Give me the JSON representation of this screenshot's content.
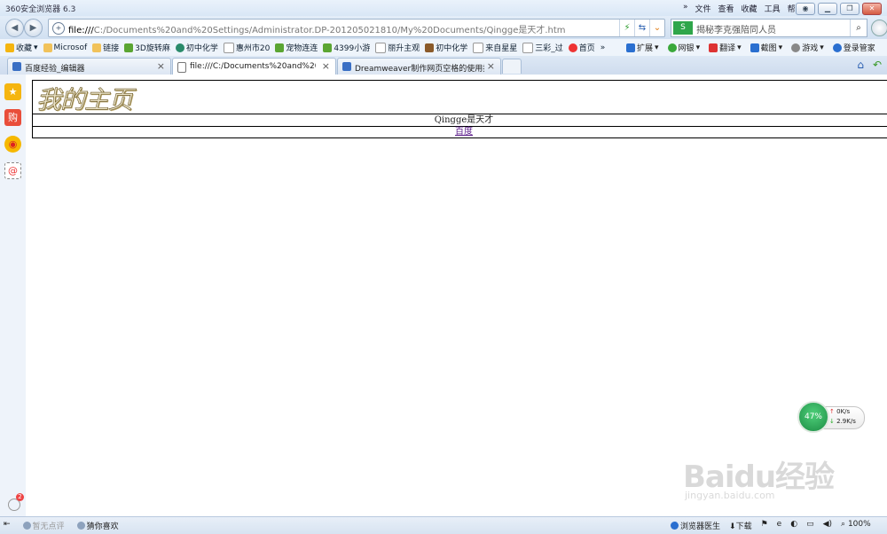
{
  "window": {
    "title": "360安全浏览器 6.3",
    "menu": [
      "»",
      "文件",
      "查看",
      "收藏",
      "工具",
      "帮助"
    ],
    "buttons": [
      "shirt",
      "minimize",
      "restore",
      "close"
    ]
  },
  "address": {
    "protocol": "file:///",
    "path": "C:/Documents%20and%20Settings/Administrator.DP-201205021810/My%20Documents/Qingge是天才.htm",
    "search_engine": "S",
    "search_text": "揭秘李克强陪同人员"
  },
  "bookmarks": {
    "items": [
      "收藏",
      "Microsof",
      "链接",
      "3D旋转麻",
      "初中化学",
      "惠州市20",
      "宠物连连",
      "4399小游",
      "丽升主观",
      "初中化学",
      "来自星星",
      "三彩_过",
      "首页",
      "»"
    ],
    "right": [
      "扩展",
      "网银",
      "翻译",
      "截图",
      "游戏",
      "登录管家"
    ]
  },
  "tabs": [
    {
      "label": "百度经验_编辑器",
      "active": false
    },
    {
      "label": "file:///C:/Documents%20and%20Setti",
      "active": true
    },
    {
      "label": "Dreamweaver制作网页空格的使用技巧_",
      "active": false
    }
  ],
  "sidebar": {
    "items": [
      "favorites-icon",
      "shopping-icon",
      "weibo-icon",
      "mail-icon"
    ],
    "badge": "2"
  },
  "page": {
    "logo_text": "我的主页",
    "name_text": "Qingge是天才",
    "link_text": "百度"
  },
  "speed": {
    "percent": "47%",
    "up": "0K/s",
    "down": "2.9K/s"
  },
  "watermark": {
    "brand": "Baidu经验",
    "sub": "jingyan.baidu.com"
  },
  "status": {
    "left": [
      "暂无点评",
      "猜你喜欢"
    ],
    "right": [
      "浏览器医生",
      "下载"
    ],
    "zoom": "100%"
  }
}
